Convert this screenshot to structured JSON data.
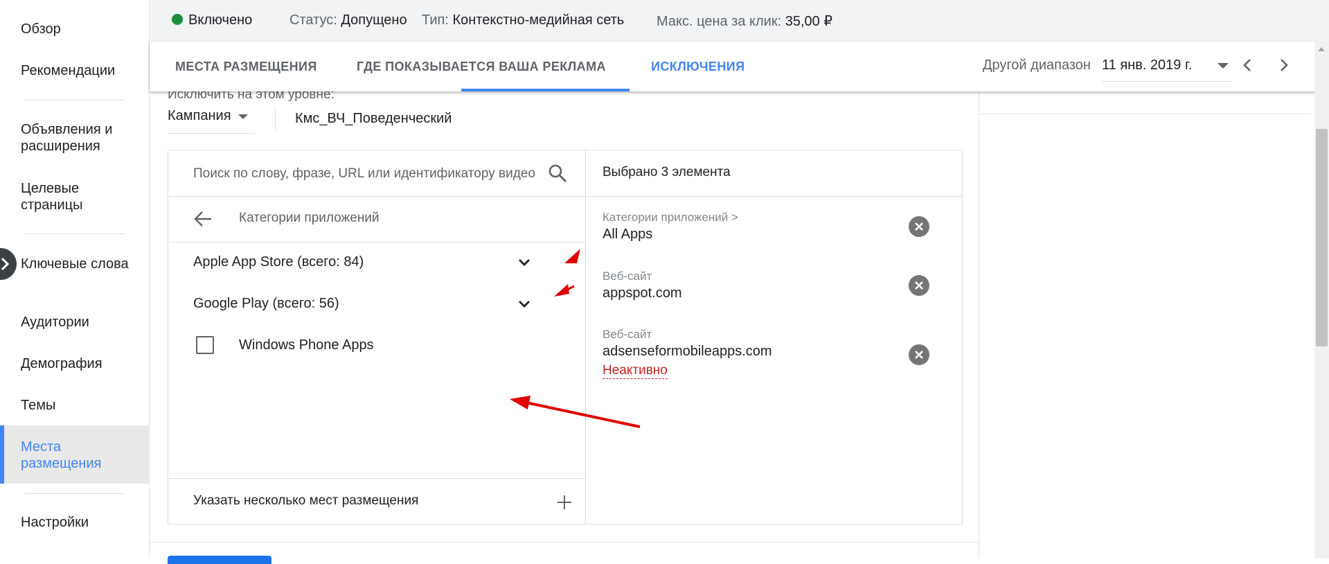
{
  "sidebar": {
    "items": [
      {
        "label": "Обзор"
      },
      {
        "label": "Рекомендации"
      },
      {
        "label": "Объявления и расширения"
      },
      {
        "label": "Целевые страницы"
      },
      {
        "label": "Ключевые слова"
      },
      {
        "label": "Аудитории"
      },
      {
        "label": "Демография"
      },
      {
        "label": "Темы"
      },
      {
        "label": "Места размещения",
        "active": true
      },
      {
        "label": "Настройки"
      }
    ]
  },
  "status": {
    "state": "Включено",
    "status_label": "Статус:",
    "status_value": "Допущено",
    "type_label": "Тип:",
    "type_value": "Контекстно-медийная сеть",
    "max_cpc_label": "Макс. цена за клик:",
    "max_cpc_value": "35,00 ₽",
    "state_color": "#1e8e3e"
  },
  "tabs": [
    {
      "label": "МЕСТА РАЗМЕЩЕНИЯ"
    },
    {
      "label": "ГДЕ ПОКАЗЫВАЕТСЯ ВАША РЕКЛАМА"
    },
    {
      "label": "ИСКЛЮЧЕНИЯ",
      "active": true
    }
  ],
  "date_range": {
    "label": "Другой диапазон",
    "value": "11 янв. 2019 г."
  },
  "exclusion": {
    "level_label": "Исключить на этом уровне:",
    "level_value": "Кампания",
    "campaign_name": "Кмс_ВЧ_Поведенческий"
  },
  "picker": {
    "search_placeholder": "Поиск по слову, фразе, URL или идентификатору видео",
    "category_title": "Категории приложений",
    "items": [
      {
        "label": "Apple App Store (всего: 84)",
        "expandable": true
      },
      {
        "label": "Google Play (всего: 56)",
        "expandable": true
      },
      {
        "label": "Windows Phone Apps",
        "checkbox": true,
        "checked": false
      }
    ],
    "bulk_label": "Указать несколько мест размещения"
  },
  "selected": {
    "count_label": "Выбрано 3 элемента",
    "items": [
      {
        "category": "Категории приложений >",
        "value": "All Apps"
      },
      {
        "category": "Веб-сайт",
        "value": "appspot.com"
      },
      {
        "category": "Веб-сайт",
        "value": "adsenseformobileapps.com",
        "status": "Неактивно"
      }
    ]
  },
  "colors": {
    "accent": "#4285f4",
    "inactive": "#c5221f",
    "annotation": "#e00000"
  }
}
